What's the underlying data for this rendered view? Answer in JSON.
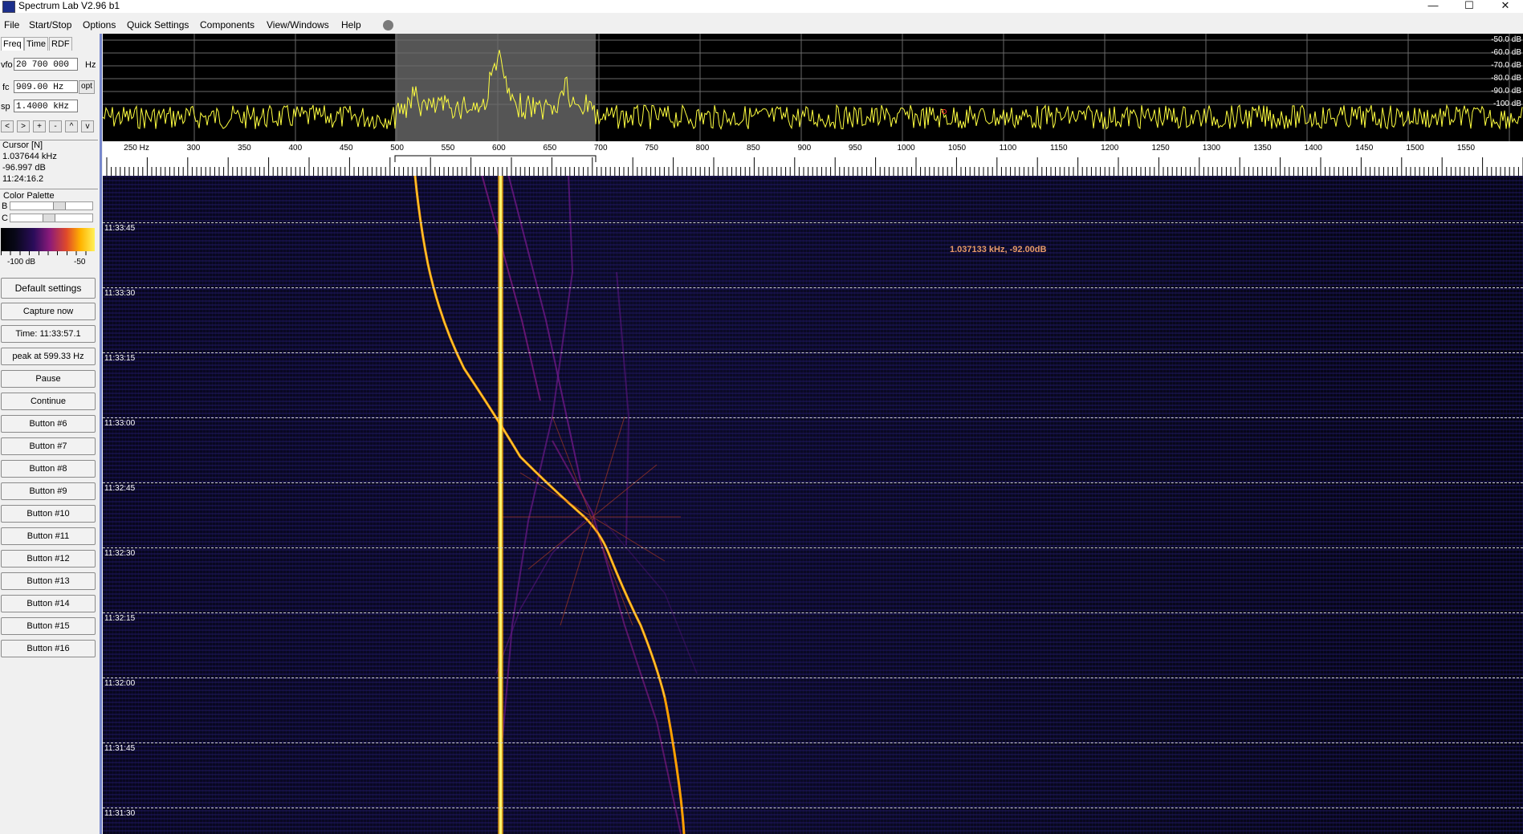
{
  "window": {
    "title": "Spectrum Lab V2.96 b1",
    "minimize": "—",
    "maximize": "☐",
    "close": "✕"
  },
  "menu": [
    "File",
    "Start/Stop",
    "Options",
    "Quick Settings",
    "Components",
    "View/Windows",
    "Help"
  ],
  "tabs": [
    "Freq",
    "Time",
    "RDF"
  ],
  "fields": {
    "vfo_label": "vfo",
    "vfo_value": "20 700 000",
    "vfo_unit": "Hz",
    "fc_label": "fc",
    "fc_value": "909.00 Hz",
    "fc_opt": "opt",
    "sp_label": "sp",
    "sp_value": "1.4000 kHz"
  },
  "nav_buttons": [
    "<",
    ">",
    "+",
    "-",
    "^",
    "v"
  ],
  "cursor": {
    "title": "Cursor [N]",
    "freq": "1.037644 kHz",
    "level": "-96.997 dB",
    "time": "11:24:16.2"
  },
  "palette": {
    "title": "Color Palette",
    "b_label": "B",
    "c_label": "C",
    "min_label": "-100 dB",
    "max_label": "-50",
    "brightness": 0.6,
    "contrast": 0.45
  },
  "buttons": {
    "default_settings": "Default settings",
    "capture_now": "Capture now",
    "time": "Time:  11:33:57.1",
    "peak": "peak at 599.33 Hz",
    "pause": "Pause",
    "continue": "Continue",
    "b6": "Button #6",
    "b7": "Button #7",
    "b8": "Button #8",
    "b9": "Button #9",
    "b10": "Button #10",
    "b11": "Button #11",
    "b12": "Button #12",
    "b13": "Button #13",
    "b14": "Button #14",
    "b15": "Button #15",
    "b16": "Button #16"
  },
  "spectrum": {
    "db_labels": [
      "-50.0 dB",
      "-60.0 dB",
      "-70.0 dB",
      "-80.0 dB",
      "-90.0 dB",
      "-100 dB"
    ],
    "freq_labels": [
      "250 Hz",
      "300",
      "350",
      "400",
      "450",
      "500",
      "550",
      "600",
      "650",
      "700",
      "750",
      "800",
      "850",
      "900",
      "950",
      "1000",
      "1050",
      "1100",
      "1150",
      "1200",
      "1250",
      "1300",
      "1350",
      "1400",
      "1450",
      "1500",
      "1550"
    ],
    "trace_color": "#ffff40"
  },
  "waterfall": {
    "time_labels": [
      "11:33:45",
      "11:33:30",
      "11:33:15",
      "11:33:00",
      "11:32:45",
      "11:32:30",
      "11:32:15",
      "11:32:00",
      "11:31:45",
      "11:31:30"
    ],
    "readout": "1.037133 kHz, -92.00dB"
  }
}
